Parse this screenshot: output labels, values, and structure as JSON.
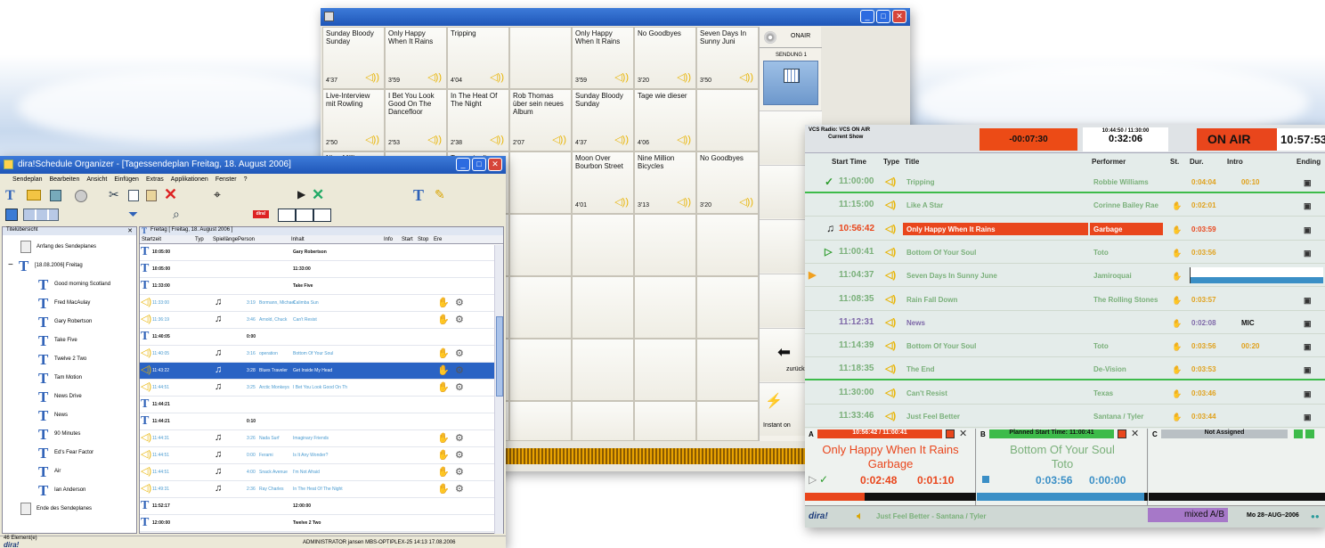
{
  "sequencer": {
    "tiles": [
      {
        "title": "Sunday Bloody Sunday",
        "dur": "4'37"
      },
      {
        "title": "Only Happy When It Rains",
        "dur": "3'59"
      },
      {
        "title": "Tripping",
        "dur": "4'04"
      },
      {
        "title": "",
        "dur": ""
      },
      {
        "title": "Only Happy When It Rains",
        "dur": "3'59"
      },
      {
        "title": "No Goodbyes",
        "dur": "3'20"
      },
      {
        "title": "Seven Days In Sunny Juni",
        "dur": "3'50"
      },
      {
        "title": "Live-Interview mit Rowling",
        "dur": "2'50"
      },
      {
        "title": "I Bet You Look Good On The Dancefloor",
        "dur": "2'53"
      },
      {
        "title": "In The Heat Of The Night",
        "dur": "2'38"
      },
      {
        "title": "Rob Thomas über sein neues Album",
        "dur": "2'07"
      },
      {
        "title": "Sunday Bloody Sunday",
        "dur": "4'37"
      },
      {
        "title": "Tage wie dieser",
        "dur": "4'06"
      },
      {
        "title": "",
        "dur": ""
      },
      {
        "title": "Nine Million Bicycles",
        "dur": ""
      },
      {
        "title": "",
        "dur": ""
      },
      {
        "title": "Tage wie dieser",
        "dur": ""
      },
      {
        "title": "",
        "dur": ""
      },
      {
        "title": "Moon Over Bourbon Street",
        "dur": "4'01"
      },
      {
        "title": "Nine Million Bicycles",
        "dur": "3'13"
      },
      {
        "title": "No Goodbyes",
        "dur": "3'20"
      }
    ],
    "onair_label": "ONAIR",
    "sendung_label": "SENDUNG 1",
    "back_label": "zurück",
    "instant_label": "Instant on"
  },
  "organizer": {
    "title": "dira!Schedule Organizer - [Tagessendeplan Freitag, 18. August 2006]",
    "menu": [
      "Sendeplan",
      "Bearbeiten",
      "Ansicht",
      "Einfügen",
      "Extras",
      "Applikationen",
      "Fenster",
      "?"
    ],
    "left_pane_title": "Titelübersicht",
    "tree": [
      "Anfang des Sendeplanes",
      "[18.08.2006] Freitag",
      "Good morning Scotland",
      "Fred MacAulay",
      "Gary Robertson",
      "Take Five",
      "Twelve 2 Two",
      "Tam Motion",
      "News Drive",
      "News",
      "90 Minutes",
      "Ed's Fear Factor",
      "Air",
      "Ian Anderson",
      "Ende des Sendeplanes"
    ],
    "tab_label": "Freitag [ Freitag, 18. August 2006 ]",
    "columns": [
      "Startzeit",
      "Typ",
      "Spiellänge",
      "Person",
      "Inhalt",
      "Info",
      "Start",
      "Stop",
      "Ere"
    ],
    "rows": [
      {
        "time": "10:05:00",
        "len": "",
        "person": "",
        "content": "Gary Robertson"
      },
      {
        "time": "10:05:00",
        "len": "",
        "person": "",
        "content": "11:33:00"
      },
      {
        "time": "11:33:00",
        "len": "",
        "person": "",
        "content": "Take Five"
      },
      {
        "time": "11:33:00",
        "len": "3:19",
        "person": "Bormann, Michael",
        "content": "Calimba Sun"
      },
      {
        "time": "11:36:19",
        "len": "3:46",
        "person": "Arnold, Chuck",
        "content": "Can't Resist"
      },
      {
        "time": "11:40:05",
        "len": "0:00",
        "person": "",
        "content": ""
      },
      {
        "time": "11:40:05",
        "len": "3:16",
        "person": "operation",
        "content": "Bottom Of Your Soul"
      },
      {
        "time": "11:43:22",
        "len": "3:28",
        "person": "Blues Traveler",
        "content": "Get Inside My Head"
      },
      {
        "time": "11:44:51",
        "len": "3:25",
        "person": "Arctic Monkeys",
        "content": "I Bet You Look Good On Th"
      },
      {
        "time": "11:44:21",
        "len": "",
        "person": "",
        "content": ""
      },
      {
        "time": "11:44:21",
        "len": "0:10",
        "person": "",
        "content": ""
      },
      {
        "time": "11:44:31",
        "len": "3:26",
        "person": "Nada Surf",
        "content": "Imaginary Friends"
      },
      {
        "time": "11:44:51",
        "len": "0:00",
        "person": "Ferami",
        "content": "Is It Any Wonder?"
      },
      {
        "time": "11:44:51",
        "len": "4:00",
        "person": "Snack Avenue",
        "content": "I'm Not Afraid"
      },
      {
        "time": "11:49:31",
        "len": "2:36",
        "person": "Ray Charles",
        "content": "In The Heat Of The Night"
      },
      {
        "time": "11:52:17",
        "len": "",
        "person": "",
        "content": "12:00:00"
      },
      {
        "time": "12:00:00",
        "len": "",
        "person": "",
        "content": "Twelve 2 Two"
      }
    ],
    "status_left": "46 Element(e)",
    "status_right": "ADMINISTRATOR   jansen  MBS-OPTIPLEX-25  14:13  17.08.2006",
    "logo": "dira!"
  },
  "onair": {
    "station": "VCS Radio: VCS ON AIR",
    "show_label": "Current Show",
    "remaining": "-00:07:30",
    "time_range": "10:44:50 / 11:30:00",
    "elapsed": "0:32:06",
    "onair_label": "ON AIR",
    "clock": "10:57:53",
    "columns": [
      "Start Time",
      "Type",
      "Title",
      "Performer",
      "St.",
      "Dur.",
      "Intro",
      "Ending"
    ],
    "rows": [
      {
        "time": "11:00:00",
        "title": "Tripping",
        "performer": "Robbie Williams",
        "dur": "0:04:04",
        "intro": "00:10",
        "state": "done"
      },
      {
        "time": "11:15:00",
        "title": "Like A Star",
        "performer": "Corinne Bailey Rae",
        "dur": "0:02:01",
        "intro": "",
        "state": "normal"
      },
      {
        "time": "10:56:42",
        "title": "Only Happy When It Rains",
        "performer": "Garbage",
        "dur": "0:03:59",
        "intro": "",
        "state": "playing"
      },
      {
        "time": "11:00:41",
        "title": "Bottom Of Your Soul",
        "performer": "Toto",
        "dur": "0:03:56",
        "intro": "",
        "state": "next"
      },
      {
        "time": "11:04:37",
        "title": "Seven Days In Sunny June",
        "performer": "Jamiroquai",
        "dur": "",
        "intro": "",
        "state": "cued"
      },
      {
        "time": "11:08:35",
        "title": "Rain Fall Down",
        "performer": "The Rolling Stones",
        "dur": "0:03:57",
        "intro": "",
        "state": "normal"
      },
      {
        "time": "11:12:31",
        "title": "News",
        "performer": "",
        "dur": "0:02:08",
        "intro": "MIC",
        "state": "news"
      },
      {
        "time": "11:14:39",
        "title": "Bottom Of Your Soul",
        "performer": "Toto",
        "dur": "0:03:56",
        "intro": "00:20",
        "state": "normal"
      },
      {
        "time": "11:18:35",
        "title": "The End",
        "performer": "De-Vision",
        "dur": "0:03:53",
        "intro": "",
        "state": "normal"
      },
      {
        "time": "11:30:00",
        "title": "Can't Resist",
        "performer": "Texas",
        "dur": "0:03:46",
        "intro": "",
        "state": "normal"
      },
      {
        "time": "11:33:46",
        "title": "Just Feel Better",
        "performer": "Santana / Tyler",
        "dur": "0:03:44",
        "intro": "",
        "state": "normal"
      }
    ],
    "player_a": {
      "letter": "A",
      "header": "10:56:42 / 11:00:41",
      "title": "Only Happy When It Rains",
      "artist": "Garbage",
      "remain": "0:02:48",
      "elapsed": "0:01:10",
      "progress": 0.35
    },
    "player_b": {
      "letter": "B",
      "header": "Planned Start Time: 11:00:41",
      "title": "Bottom Of Your Soul",
      "artist": "Toto",
      "remain": "0:03:56",
      "elapsed": "0:00:00",
      "progress": 0.98
    },
    "player_c": {
      "letter": "C",
      "header": "Not Assigned"
    },
    "footer_logo": "dira!",
    "footer_next": "Just Feel Better  -  Santana / Tyler",
    "footer_mode": "mixed A/B",
    "footer_date": "Mo 28–AUG–2006"
  }
}
